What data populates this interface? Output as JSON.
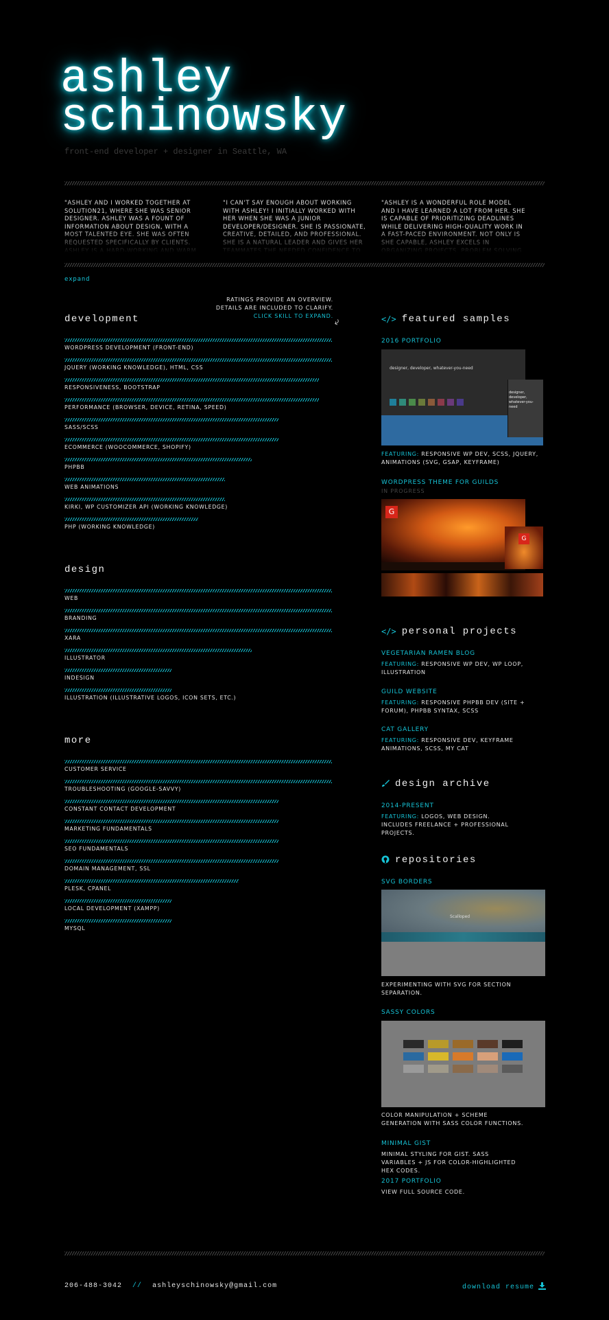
{
  "header": {
    "name_line1": "ashley",
    "name_line2": "schinowsky",
    "tagline": "front-end developer + designer in Seattle, WA"
  },
  "testimonials": [
    "\"Ashley and I worked together at Solution21, where she was Senior Designer. Ashley was a fount of information about design, with a most talented eye. She was often requested specifically by clients. Ashley is a hard-working and warm co-worker, an inspiring designer, and a joy to",
    "\"I can't say enough about working with Ashley! I initially worked with her when she was a junior developer/designer. She is passionate, creative, detailed, and professional. She is a natural leader and gives her teammates the needed confidence to succeed. She is able to manage multiple",
    "\"Ashley is a wonderful role model and I have learned a lot from her. She is capable of prioritizing deadlines while delivering high-quality work in a fast-paced environment. Not only is she capable, Ashley excels in organizing projects, problem solving, communicating, and"
  ],
  "expand_label": "expand",
  "ratings_note": {
    "line1": "Ratings provide an overview.",
    "line2": "Details are included to clarify.",
    "line3": "Click skill to expand."
  },
  "skills": {
    "development": {
      "title": "development",
      "items": [
        {
          "label": "WordPress Development (front-end)",
          "level": 1.0
        },
        {
          "label": "jQuery (working knowledge), HTML, CSS",
          "level": 1.0
        },
        {
          "label": "Responsiveness, Bootstrap",
          "level": 0.95
        },
        {
          "label": "Performance (Browser, Device, Retina, Speed)",
          "level": 0.95
        },
        {
          "label": "Sass/SCSS",
          "level": 0.8
        },
        {
          "label": "Ecommerce (WooCommerce, Shopify)",
          "level": 0.8
        },
        {
          "label": "phpBB",
          "level": 0.7
        },
        {
          "label": "Web Animations",
          "level": 0.6
        },
        {
          "label": "Kirki, WP Customizer API (working knowledge)",
          "level": 0.6
        },
        {
          "label": "PHP (working knowledge)",
          "level": 0.5
        }
      ]
    },
    "design": {
      "title": "design",
      "items": [
        {
          "label": "Web",
          "level": 1.0
        },
        {
          "label": "Branding",
          "level": 1.0
        },
        {
          "label": "XARA",
          "level": 1.0
        },
        {
          "label": "Illustrator",
          "level": 0.7
        },
        {
          "label": "InDesign",
          "level": 0.4
        },
        {
          "label": "Illustration (Illustrative logos, icon sets, etc.)",
          "level": 0.4
        }
      ]
    },
    "more": {
      "title": "more",
      "items": [
        {
          "label": "Customer Service",
          "level": 1.0
        },
        {
          "label": "Troubleshooting (Google-Savvy)",
          "level": 1.0
        },
        {
          "label": "Constant Contact Development",
          "level": 0.8
        },
        {
          "label": "Marketing Fundamentals",
          "level": 0.8
        },
        {
          "label": "SEO Fundamentals",
          "level": 0.8
        },
        {
          "label": "Domain Management, SSL",
          "level": 0.8
        },
        {
          "label": "Plesk, cPanel",
          "level": 0.65
        },
        {
          "label": "Local Development (XAMPP)",
          "level": 0.4
        },
        {
          "label": "MySQL",
          "level": 0.4
        }
      ]
    }
  },
  "featured": {
    "title": "featured samples",
    "portfolio_title": "2016 Portfolio",
    "portfolio_feat_label": "Featuring:",
    "portfolio_feat": "Responsive WP Dev, SCSS, jQuery, Animations (SVG, GSAP, Keyframe)",
    "guild_title": "WordPress Theme for Guilds",
    "guild_status": "In Progress",
    "thumb_text": "designer, developer, whatever-you-need",
    "thumb_text_small": "designer, developer, whatever-you-need"
  },
  "personal": {
    "title": "personal projects",
    "items": [
      {
        "title": "Vegetarian Ramen Blog",
        "feat_label": "Featuring:",
        "feat": "Responsive WP Dev, WP Loop, Illustration"
      },
      {
        "title": "Guild Website",
        "feat_label": "Featuring:",
        "feat": "Responsive phpBB Dev (site + forum), phpBB Syntax, SCSS"
      },
      {
        "title": "Cat Gallery",
        "feat_label": "Featuring:",
        "feat": "Responsive Dev, Keyframe Animations, SCSS, My Cat"
      }
    ]
  },
  "archive": {
    "title": "design archive",
    "item_title": "2014-Present",
    "feat_label": "Featuring:",
    "feat": "Logos, web design. Includes freelance + professional projects."
  },
  "repos": {
    "title": "repositories",
    "svg_title": "SVG Borders",
    "svg_desc": "Experimenting with SVG for section separation.",
    "scalloped": "Scalloped",
    "sassy_title": "Sassy Colors",
    "sassy_desc": "Color manipulation + scheme generation with Sass color functions.",
    "gist_title": "Minimal Gist",
    "gist_desc": "Minimal styling for Gist. Sass variables + JS for color-highlighted hex codes.",
    "p2017_title": "2017 Portfolio",
    "p2017_desc": "View full source code."
  },
  "footer": {
    "phone": "206-488-3042",
    "sep": "//",
    "email": "ashleyschinowsky@gmail.com",
    "download": "download resume"
  },
  "colors": {
    "accent": "#16c3d6",
    "background": "#000000"
  }
}
